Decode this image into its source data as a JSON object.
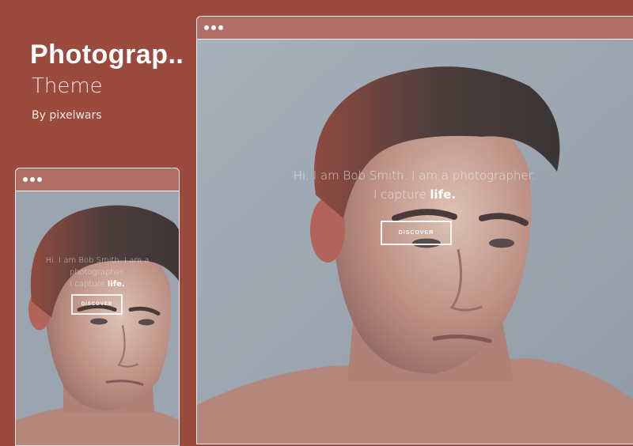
{
  "header": {
    "title": "Photograp..",
    "subtitle": "Theme",
    "author": "By pixelwars"
  },
  "hero": {
    "intro": "Hi. I am Bob Smith. I am a photographer.",
    "small_intro_line1": "Hi. I am Bob Smith. I am a",
    "small_intro_line2": "photographer.",
    "capture_prefix": "I capture ",
    "capture_emphasis": "life.",
    "button_label": "DISCOVER"
  },
  "colors": {
    "background": "#9b4a3e",
    "window_bar": "#b06e66",
    "photo_background": "#aeb6be"
  }
}
